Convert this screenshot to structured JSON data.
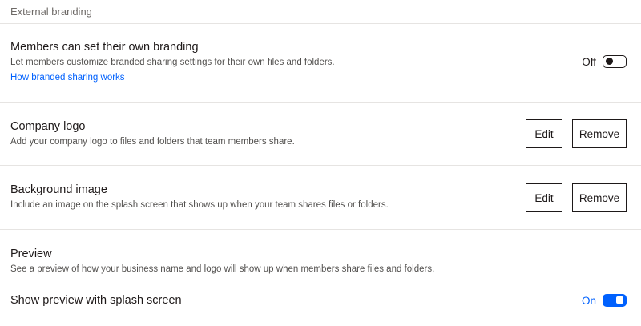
{
  "section": {
    "title": "External branding"
  },
  "member_branding": {
    "title": "Members can set their own branding",
    "description": "Let members customize branded sharing settings for their own files and folders.",
    "link": "How branded sharing works",
    "toggle_label": "Off",
    "toggle_state": "off"
  },
  "company_logo": {
    "title": "Company logo",
    "description": "Add your company logo to files and folders that team members share.",
    "edit_label": "Edit",
    "remove_label": "Remove"
  },
  "background_image": {
    "title": "Background image",
    "description": "Include an image on the splash screen that shows up when your team shares files or folders.",
    "edit_label": "Edit",
    "remove_label": "Remove"
  },
  "preview": {
    "title": "Preview",
    "description": "See a preview of how your business name and logo will show up when members share files and folders.",
    "splash_label": "Show preview with splash screen",
    "toggle_label": "On",
    "toggle_state": "on"
  },
  "colors": {
    "accent": "#0061fe",
    "text": "#1e1919",
    "muted": "#52504e",
    "divider": "#e6e4e2"
  }
}
